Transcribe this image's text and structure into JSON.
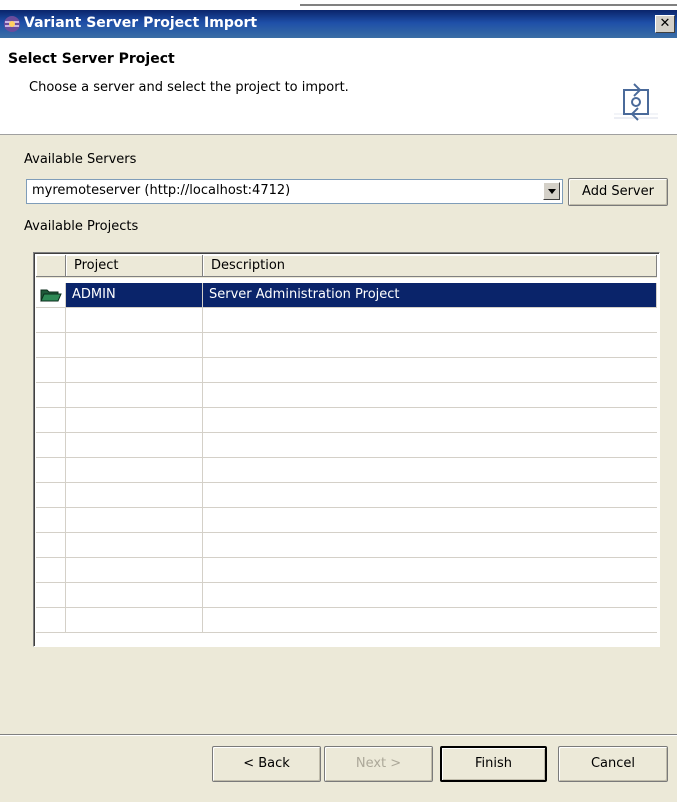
{
  "window": {
    "title": "Variant Server Project Import",
    "close_label": "✕"
  },
  "header": {
    "heading": "Select Server Project",
    "description": "Choose a server and select the project to import."
  },
  "servers": {
    "label": "Available Servers",
    "selected": "myremoteserver (http://localhost:4712)",
    "add_button": "Add Server"
  },
  "projects": {
    "label": "Available Projects",
    "columns": [
      "",
      "Project",
      "Description"
    ],
    "rows": [
      {
        "icon": "folder-open-icon",
        "project": "ADMIN",
        "description": "Server Administration Project",
        "selected": true
      }
    ]
  },
  "footer": {
    "back": "< Back",
    "next": "Next >",
    "finish": "Finish",
    "cancel": "Cancel"
  },
  "colors": {
    "selection": "#0a246a",
    "titlebar": "#0a246a",
    "dialog_bg": "#ece9d8"
  }
}
